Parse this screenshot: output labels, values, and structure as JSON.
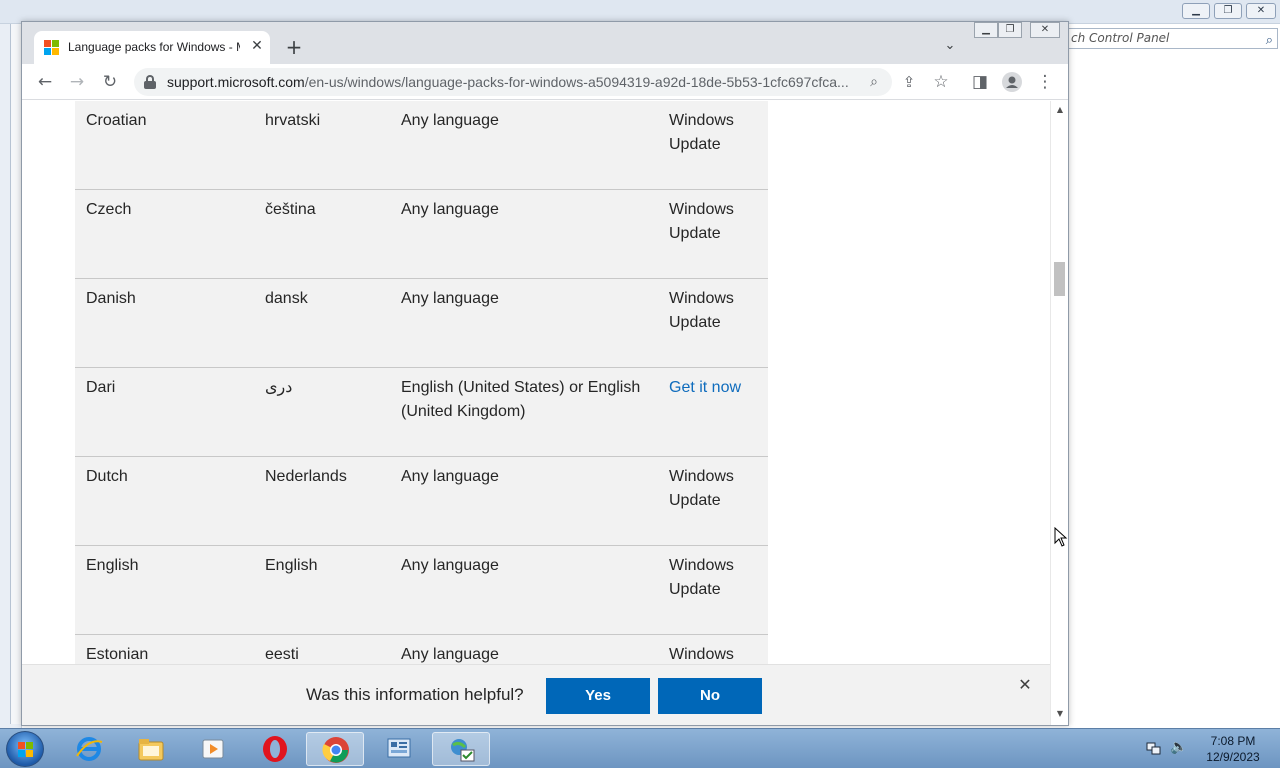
{
  "background_window": {
    "search_placeholder": "ch Control Panel",
    "search_icon": "magnifier-icon"
  },
  "browser": {
    "tab": {
      "title": "Language packs for Windows - Microsoft Support",
      "close_glyph": "✕"
    },
    "new_tab_glyph": "+",
    "tab_search_glyph": "⌄",
    "url": {
      "host": "support.microsoft.com",
      "path": "/en-us/windows/language-packs-for-windows-a5094319-a92d-18de-5b53-1cfc697cfca..."
    },
    "icons": [
      "back-arrow-icon",
      "forward-arrow-icon",
      "reload-icon",
      "lock-icon",
      "zoom-icon",
      "share-icon",
      "bookmark-star-icon",
      "side-panel-icon",
      "profile-icon",
      "kebab-menu-icon"
    ],
    "colors": {
      "tabstrip": "#dee1e6",
      "omnibox": "#f1f3f4"
    }
  },
  "table": {
    "rows": [
      {
        "language": "Croatian",
        "native": "hrvatski",
        "base": "Any language",
        "source": "Windows Update",
        "source_is_link": false
      },
      {
        "language": "Czech",
        "native": "čeština",
        "base": "Any language",
        "source": "Windows Update",
        "source_is_link": false
      },
      {
        "language": "Danish",
        "native": "dansk",
        "base": "Any language",
        "source": "Windows Update",
        "source_is_link": false
      },
      {
        "language": "Dari",
        "native": "درى",
        "base": "English (United States) or English (United Kingdom)",
        "source": "Get it now",
        "source_is_link": true
      },
      {
        "language": "Dutch",
        "native": "Nederlands",
        "base": "Any language",
        "source": "Windows Update",
        "source_is_link": false
      },
      {
        "language": "English",
        "native": "English",
        "base": "Any language",
        "source": "Windows Update",
        "source_is_link": false
      },
      {
        "language": "Estonian",
        "native": "eesti",
        "base": "Any language",
        "source": "Windows",
        "source_is_link": false
      }
    ],
    "colors": {
      "row_bg": "#f2f2f2",
      "link": "#0f6cbd",
      "text": "#262626"
    }
  },
  "feedback": {
    "question": "Was this information helpful?",
    "yes_label": "Yes",
    "no_label": "No",
    "close_glyph": "✕",
    "button_color": "#0067b8"
  },
  "taskbar": {
    "apps": [
      "start-orb",
      "internet-explorer-icon",
      "file-explorer-icon",
      "media-player-icon",
      "opera-icon",
      "chrome-icon",
      "control-panel-icon",
      "network-tool-icon"
    ],
    "active_app": "chrome-icon",
    "clock_time": "7:08 PM",
    "clock_date": "12/9/2023"
  }
}
